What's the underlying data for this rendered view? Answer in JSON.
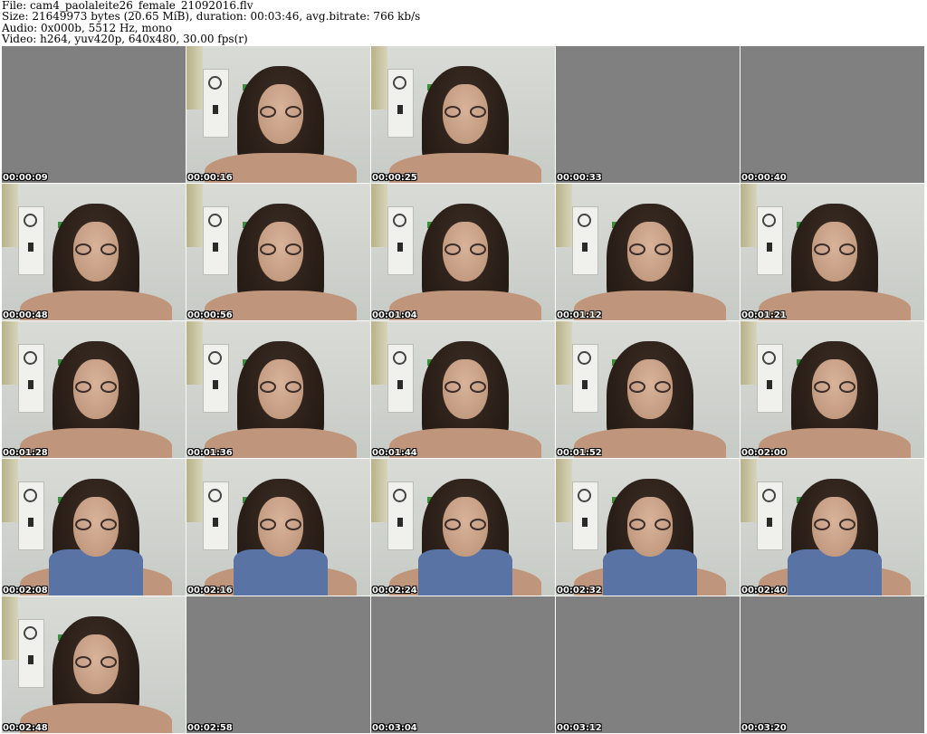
{
  "header": {
    "line1": "File: cam4_paolaleite26_female_21092016.flv",
    "line2": "Size: 21649973 bytes (20.65 MiB), duration: 00:03:46, avg.bitrate: 766 kb/s",
    "line3": "Audio: 0x000b, 5512 Hz, mono",
    "line4": "Video: h264, yuv420p, 640x480, 30.00 fps(r)"
  },
  "thumbnails": [
    {
      "time": "00:00:09",
      "kind": "blank"
    },
    {
      "time": "00:00:16",
      "kind": "face"
    },
    {
      "time": "00:00:25",
      "kind": "face"
    },
    {
      "time": "00:00:33",
      "kind": "blank"
    },
    {
      "time": "00:00:40",
      "kind": "blank"
    },
    {
      "time": "00:00:48",
      "kind": "face"
    },
    {
      "time": "00:00:56",
      "kind": "face"
    },
    {
      "time": "00:01:04",
      "kind": "face"
    },
    {
      "time": "00:01:12",
      "kind": "face"
    },
    {
      "time": "00:01:21",
      "kind": "face"
    },
    {
      "time": "00:01:28",
      "kind": "face"
    },
    {
      "time": "00:01:36",
      "kind": "face"
    },
    {
      "time": "00:01:44",
      "kind": "face"
    },
    {
      "time": "00:01:52",
      "kind": "face"
    },
    {
      "time": "00:02:00",
      "kind": "face"
    },
    {
      "time": "00:02:08",
      "kind": "torso"
    },
    {
      "time": "00:02:16",
      "kind": "torso"
    },
    {
      "time": "00:02:24",
      "kind": "torso"
    },
    {
      "time": "00:02:32",
      "kind": "torso"
    },
    {
      "time": "00:02:40",
      "kind": "torso"
    },
    {
      "time": "00:02:48",
      "kind": "face"
    },
    {
      "time": "00:02:58",
      "kind": "blank"
    },
    {
      "time": "00:03:04",
      "kind": "blank"
    },
    {
      "time": "00:03:12",
      "kind": "blank"
    },
    {
      "time": "00:03:20",
      "kind": "blank"
    }
  ],
  "colors": {
    "blank_frame": "#808080",
    "timestamp_text": "#ffffff",
    "timestamp_outline": "#000000"
  }
}
